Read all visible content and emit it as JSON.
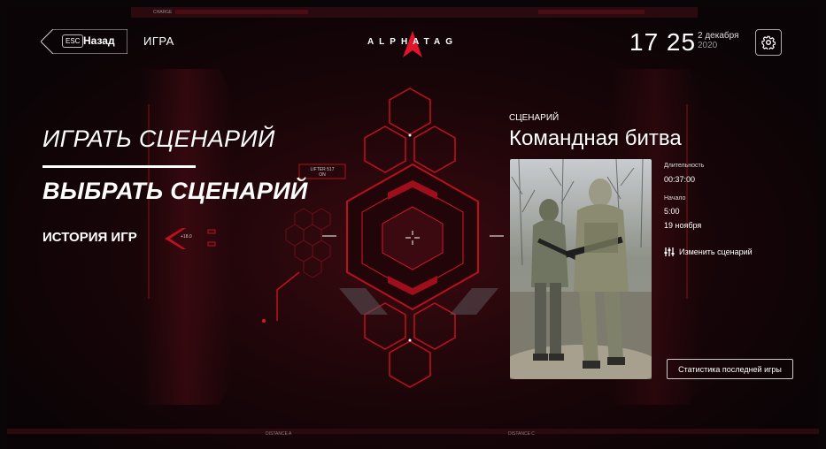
{
  "header": {
    "back_key": "ESC",
    "back_label": "Назад",
    "section_title": "ИГРА",
    "logo_text": "ALPHATAG",
    "time": "17 25",
    "date_line1": "2 декабря",
    "date_line2": "2020",
    "settings_icon": "gear-icon"
  },
  "menu": {
    "play": "ИГРАТЬ СЦЕНАРИЙ",
    "choose": "ВЫБРАТЬ СЦЕНАРИЙ",
    "history": "ИСТОРИЯ ИГР"
  },
  "hud": {
    "top_label": "CHARGE",
    "lifter": "LIFTER 517",
    "lifter_state": "ON",
    "angle": "+18.0",
    "dist_a": "DISTANCE A",
    "dist_c": "DISTANCE C"
  },
  "scenario": {
    "label": "СЦЕНАРИЙ",
    "name": "Командная битва",
    "duration_label": "Длительность",
    "duration_value": "00:37:00",
    "start_label": "Начало",
    "start_time": "5:00",
    "start_date": "19 ноября",
    "change_label": "Изменить сценарий",
    "change_icon": "sliders-icon",
    "stats_button": "Статистика последней игры"
  },
  "colors": {
    "accent": "#e0142a",
    "background": "#0b0406"
  }
}
